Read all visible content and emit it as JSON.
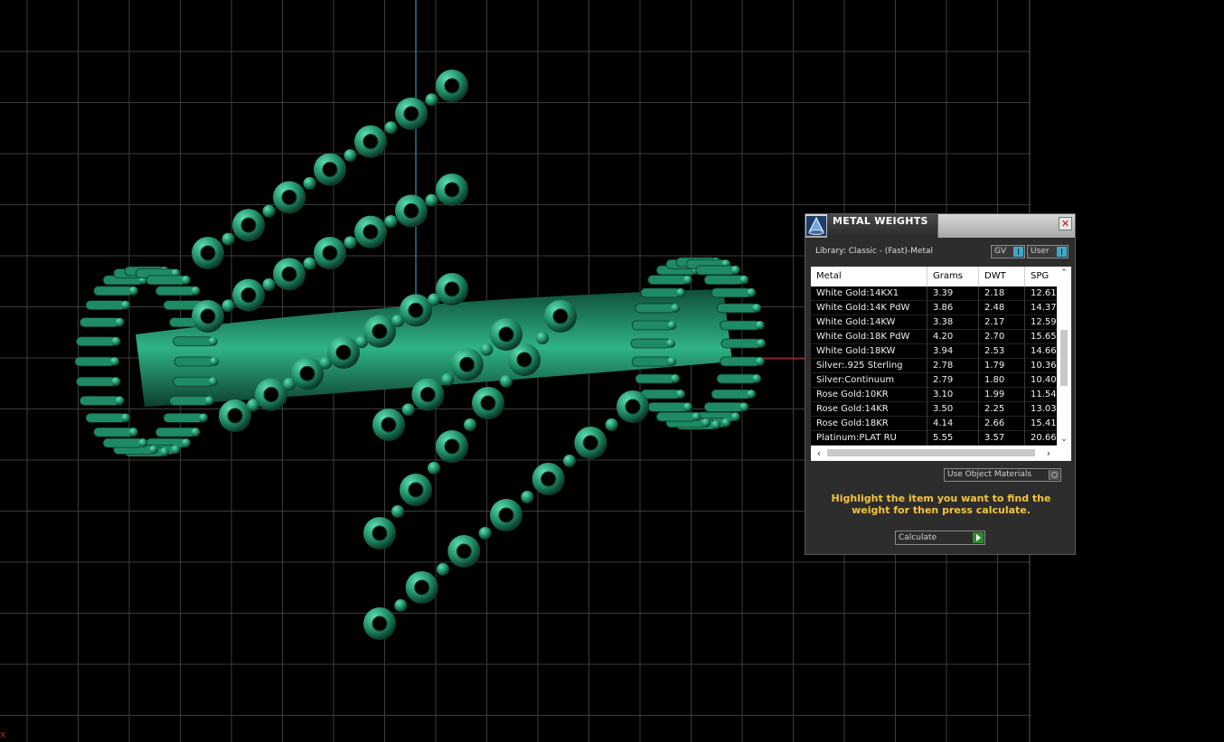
{
  "viewport": {
    "grid_color": "#3c3c3c",
    "axis_x_color": "#b01818",
    "axis_y_color": "#2a8fb0",
    "model_color": "#1f8a66",
    "model_highlight": "#5fe0b2",
    "corner_marker": "x"
  },
  "panel": {
    "title": "METAL WEIGHTS",
    "close_icon": "close-icon",
    "library_label": "Library: Classic - (Fast)-Metal",
    "toggle_gv": "GV",
    "toggle_user": "User",
    "columns": [
      "Metal",
      "Grams",
      "DWT",
      "SPG"
    ],
    "rows": [
      [
        "White Gold:14KX1",
        "3.39",
        "2.18",
        "12.61"
      ],
      [
        "White Gold:14K PdW",
        "3.86",
        "2.48",
        "14.37"
      ],
      [
        "White Gold:14KW",
        "3.38",
        "2.17",
        "12.59"
      ],
      [
        "White Gold:18K PdW",
        "4.20",
        "2.70",
        "15.65"
      ],
      [
        "White Gold:18KW",
        "3.94",
        "2.53",
        "14.66"
      ],
      [
        "Silver:.925 Sterling",
        "2.78",
        "1.79",
        "10.36"
      ],
      [
        "Silver:Continuum",
        "2.79",
        "1.80",
        "10.40"
      ],
      [
        "Rose Gold:10KR",
        "3.10",
        "1.99",
        "11.54"
      ],
      [
        "Rose Gold:14KR",
        "3.50",
        "2.25",
        "13.03"
      ],
      [
        "Rose Gold:18KR",
        "4.14",
        "2.66",
        "15.41"
      ],
      [
        "Platinum:PLAT RU",
        "5.55",
        "3.57",
        "20.66"
      ]
    ],
    "use_object_materials": "Use Object Materials",
    "hint": "Highlight the item you want to find the weight for then press calculate.",
    "calculate_label": "Calculate",
    "accent": "#f2c53d"
  }
}
